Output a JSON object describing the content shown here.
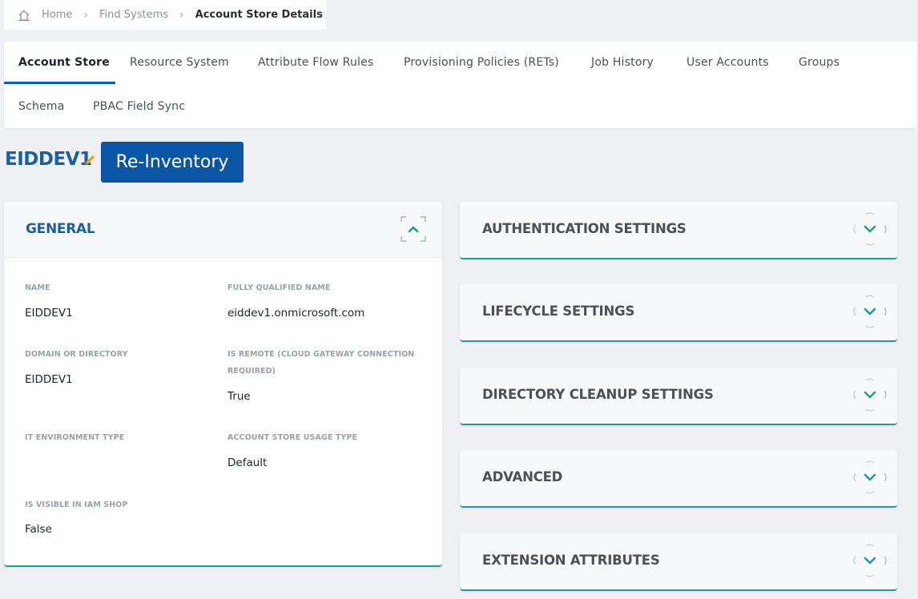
{
  "breadcrumb": {
    "home_icon": "home-icon",
    "items": [
      "Home",
      "Find Systems",
      "Account Store Details"
    ]
  },
  "tabs": [
    {
      "label": "Account Store",
      "active": true
    },
    {
      "label": "Resource System"
    },
    {
      "label": "Attribute Flow Rules"
    },
    {
      "label": "Provisioning Policies (RETs)"
    },
    {
      "label": "Job History"
    },
    {
      "label": "User Accounts"
    },
    {
      "label": "Groups"
    },
    {
      "label": "Schema"
    },
    {
      "label": "PBAC Field Sync"
    }
  ],
  "store": {
    "name": "EIDDEV1",
    "edit_icon": "pencil-icon",
    "reinventory_label": "Re-Inventory"
  },
  "general": {
    "title": "GENERAL",
    "fields": [
      {
        "label": "NAME",
        "value": "EIDDEV1"
      },
      {
        "label": "FULLY QUALIFIED NAME",
        "value": "eiddev1.onmicrosoft.com"
      },
      {
        "label": "DOMAIN OR DIRECTORY",
        "value": "EIDDEV1"
      },
      {
        "label_line1": "IS REMOTE (CLOUD GATEWAY CONNECTION",
        "label_line2": "REQUIRED)",
        "value": "True"
      },
      {
        "label": "IT ENVIRONMENT TYPE",
        "value": ""
      },
      {
        "label": "ACCOUNT STORE USAGE TYPE",
        "value": "Default"
      },
      {
        "label": "IS VISIBLE IN IAM SHOP",
        "value": "False"
      }
    ]
  },
  "accordions": [
    {
      "title": "AUTHENTICATION SETTINGS"
    },
    {
      "title": "LIFECYCLE SETTINGS"
    },
    {
      "title": "DIRECTORY CLEANUP SETTINGS"
    },
    {
      "title": "ADVANCED"
    },
    {
      "title": "EXTENSION ATTRIBUTES"
    }
  ],
  "colors": {
    "accent": "#0b56a4",
    "teal": "#1f9c93",
    "title_blue": "#1c5f9e",
    "edit_orange": "#f0a020"
  }
}
